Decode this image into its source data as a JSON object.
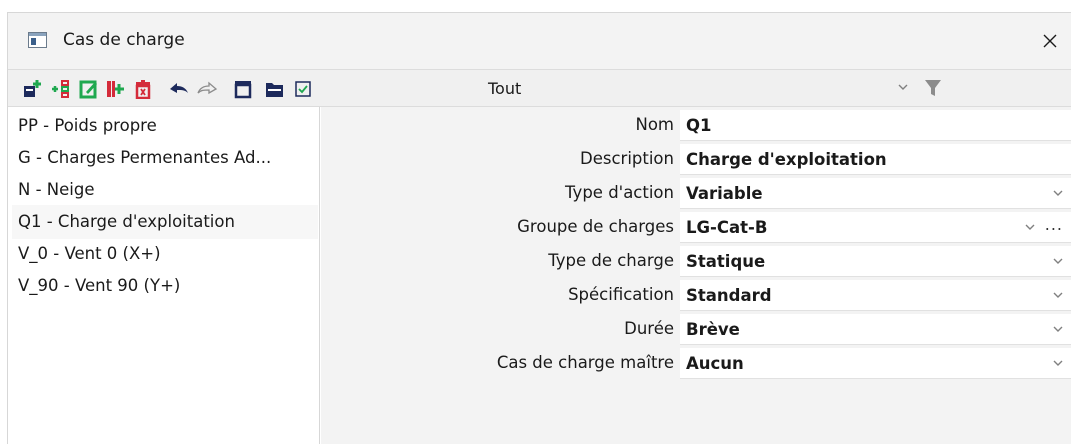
{
  "window": {
    "title": "Cas de charge"
  },
  "toolbar": {
    "filter_value": "Tout",
    "icons": [
      "new-load-case-icon",
      "insert-icon",
      "edit-icon",
      "copy-icon",
      "delete-icon",
      "undo-icon",
      "redo-icon",
      "table-icon",
      "folder-icon",
      "checkbox-icon",
      "filter-icon"
    ],
    "colors": {
      "green": "#1fa84f",
      "red": "#d42b3a",
      "navy": "#1d2a5c",
      "filter_gray": "#8c8c8c"
    }
  },
  "load_cases": [
    {
      "label": "PP - Poids propre"
    },
    {
      "label": "G - Charges Permenantes Ad..."
    },
    {
      "label": "N - Neige"
    },
    {
      "label": "Q1 - Charge d'exploitation",
      "selected": true
    },
    {
      "label": "V_0 - Vent 0 (X+)"
    },
    {
      "label": "V_90 - Vent 90 (Y+)"
    }
  ],
  "properties": {
    "nom": {
      "label": "Nom",
      "value": "Q1"
    },
    "description": {
      "label": "Description",
      "value": "Charge d'exploitation"
    },
    "type_action": {
      "label": "Type d'action",
      "value": "Variable"
    },
    "groupe": {
      "label": "Groupe de charges",
      "value": "LG-Cat-B",
      "more": "..."
    },
    "type_charge": {
      "label": "Type de charge",
      "value": "Statique"
    },
    "specification": {
      "label": "Spécification",
      "value": "Standard"
    },
    "duree": {
      "label": "Durée",
      "value": "Brève"
    },
    "maitre": {
      "label": "Cas de charge maître",
      "value": "Aucun"
    }
  }
}
